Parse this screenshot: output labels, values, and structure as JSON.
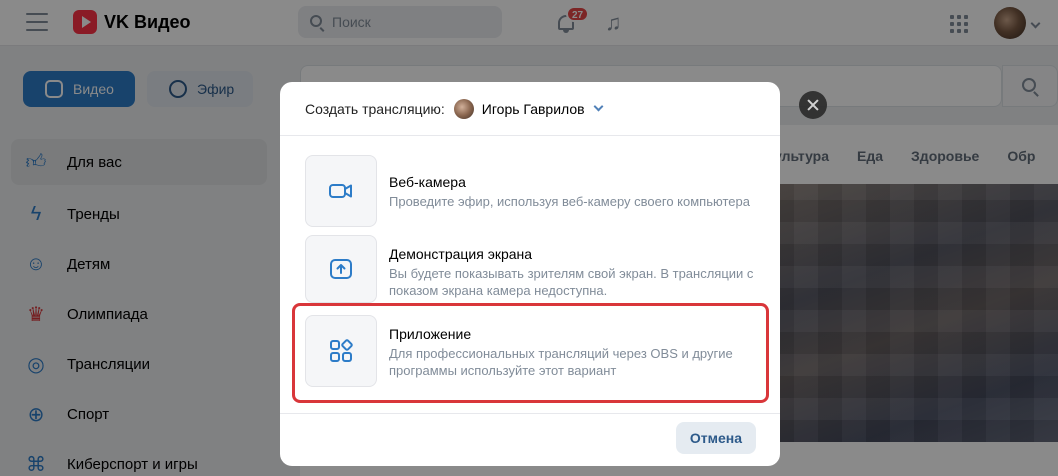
{
  "header": {
    "logo_text": "VK Видео",
    "search_placeholder": "Поиск",
    "notifications_count": "27"
  },
  "left_panel": {
    "video_pill": "Видео",
    "live_pill": "Эфир",
    "nav": [
      {
        "label": "Для вас",
        "icon": "thumbs-up-icon"
      },
      {
        "label": "Тренды",
        "icon": "lightning-icon"
      },
      {
        "label": "Детям",
        "icon": "kids-icon"
      },
      {
        "label": "Олимпиада",
        "icon": "trophy-icon"
      },
      {
        "label": "Трансляции",
        "icon": "broadcast-icon"
      },
      {
        "label": "Спорт",
        "icon": "ball-icon"
      },
      {
        "label": "Киберспорт и игры",
        "icon": "gamepad-icon"
      }
    ]
  },
  "content": {
    "categories": [
      "ультура",
      "Еда",
      "Здоровье",
      "Обр"
    ]
  },
  "modal": {
    "header_label": "Создать трансляцию:",
    "user_name": "Игорь Гаврилов",
    "options": [
      {
        "title": "Веб-камера",
        "desc": "Проведите эфир, используя веб-камеру своего компьютера",
        "icon": "camera-icon"
      },
      {
        "title": "Демонстрация экрана",
        "desc": "Вы будете показывать зрителям свой экран. В трансляции с показом экрана камера недоступна.",
        "icon": "screen-share-icon"
      },
      {
        "title": "Приложение",
        "desc": "Для профессиональных трансляций через OBS и другие программы используйте этот вариант",
        "icon": "apps-icon"
      }
    ],
    "cancel_label": "Отмена"
  },
  "colors": {
    "accent": "#2d7cc8",
    "highlight": "#d9363a",
    "badge": "#e64646"
  }
}
